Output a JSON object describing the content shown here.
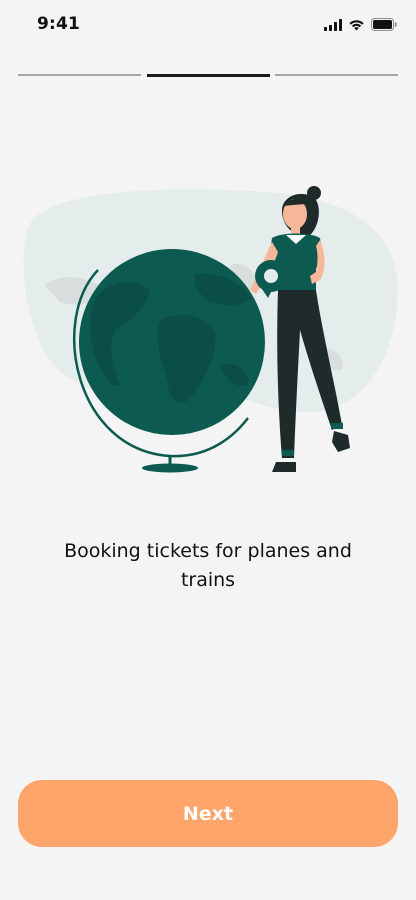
{
  "status_bar": {
    "time": "9:41",
    "icons": [
      "signal-icon",
      "wifi-icon",
      "battery-icon"
    ]
  },
  "onboarding": {
    "steps_total": 3,
    "current_step": 2,
    "caption": "Booking tickets for planes and trains",
    "illustration": "woman-with-globe-illustration"
  },
  "actions": {
    "next_label": "Next"
  },
  "colors": {
    "background": "#f4f4f4",
    "accent": "#ffa56c",
    "globe": "#0d5b50",
    "blob": "#e4ecec"
  }
}
